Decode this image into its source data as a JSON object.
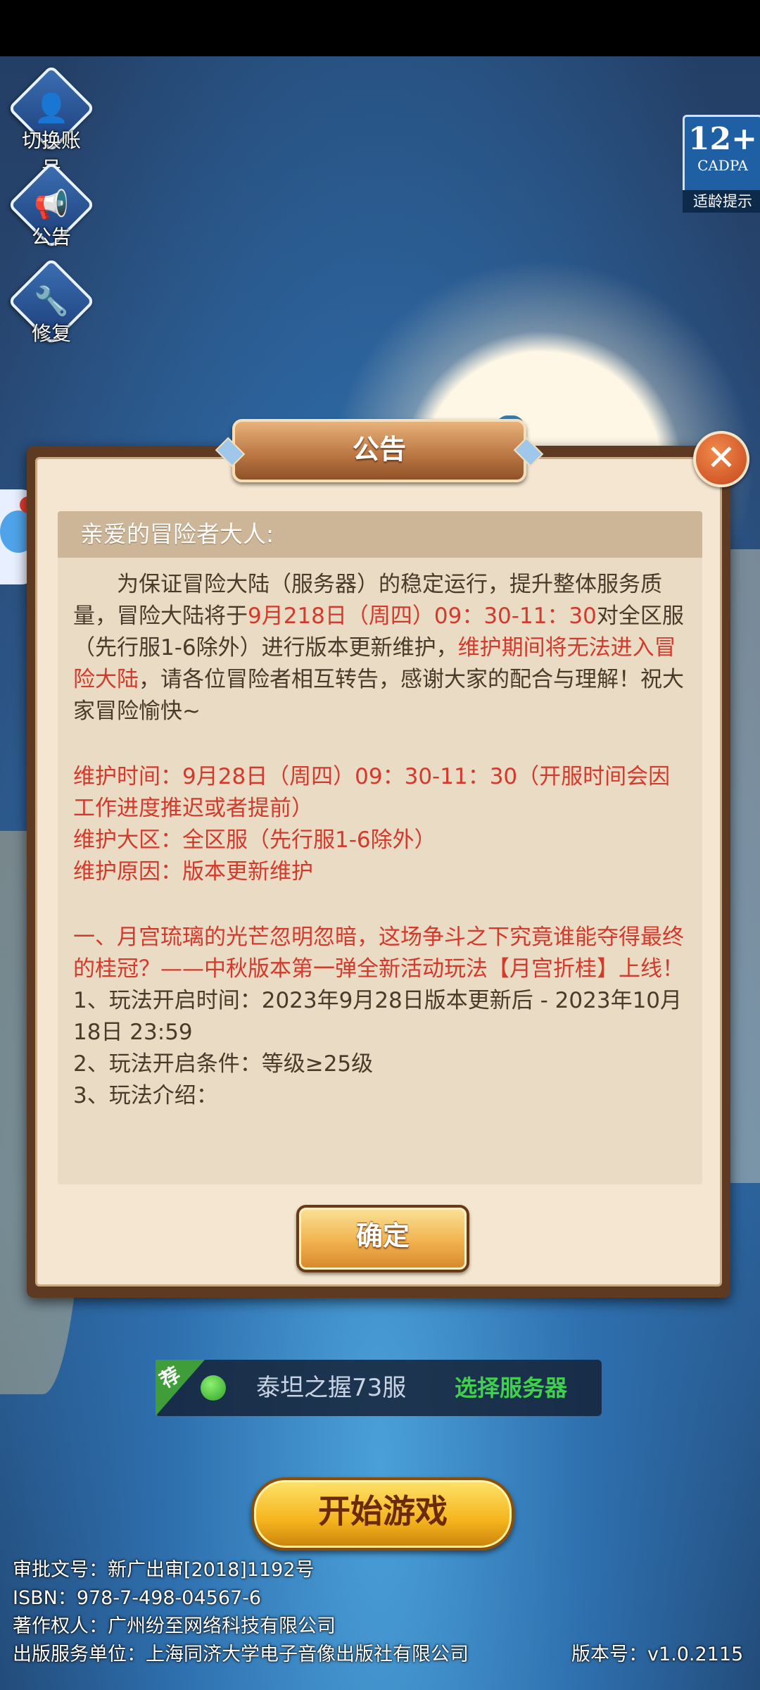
{
  "side_menu": {
    "switch_account": "切换账号",
    "announcement": "公告",
    "repair": "修复"
  },
  "age_badge": {
    "rating": "12+",
    "org": "CADPA",
    "tip": "适龄提示"
  },
  "dialog": {
    "title": "公告",
    "greeting": "亲爱的冒险者大人:",
    "para1_normal_a": "为保证冒险大陆（服务器）的稳定运行，提升整体服务质量，冒险大陆将于",
    "para1_red_date": "9月218日（周四）09：30-11：30",
    "para1_normal_b": "对全区服（先行服1-6除外）进行版本更新维护，",
    "para1_red_b": "维护期间将无法进入冒险大陆",
    "para1_normal_c": "，请各位冒险者相互转告，感谢大家的配合与理解！祝大家冒险愉快~",
    "maint_time": "维护时间：9月28日（周四）09：30-11：30（开服时间会因工作进度推迟或者提前）",
    "maint_area": "维护大区：全区服（先行服1-6除外）",
    "maint_reason": "维护原因：版本更新维护",
    "section1_title": "一、月宫琉璃的光芒忽明忽暗，这场争斗之下究竟谁能夺得最终的桂冠？——中秋版本第一弹全新活动玩法【月宫折桂】上线！",
    "item1": "1、玩法开启时间：2023年9月28日版本更新后 - 2023年10月18日 23:59",
    "item2": "2、玩法开启条件：等级≥25级",
    "item3": "3、玩法介绍：",
    "confirm": "确定",
    "close_icon": "✕"
  },
  "server": {
    "tag": "荐",
    "name": "泰坦之握73服",
    "select": "选择服务器"
  },
  "start_button": "开始游戏",
  "footer": {
    "approval": "审批文号：新广出审[2018]1192号",
    "isbn": "ISBN：978-7-498-04567-6",
    "copyright": "著作权人：广州纷至网络科技有限公司",
    "publisher": "出版服务单位：上海同济大学电子音像出版社有限公司",
    "version": "版本号：v1.0.2115"
  }
}
